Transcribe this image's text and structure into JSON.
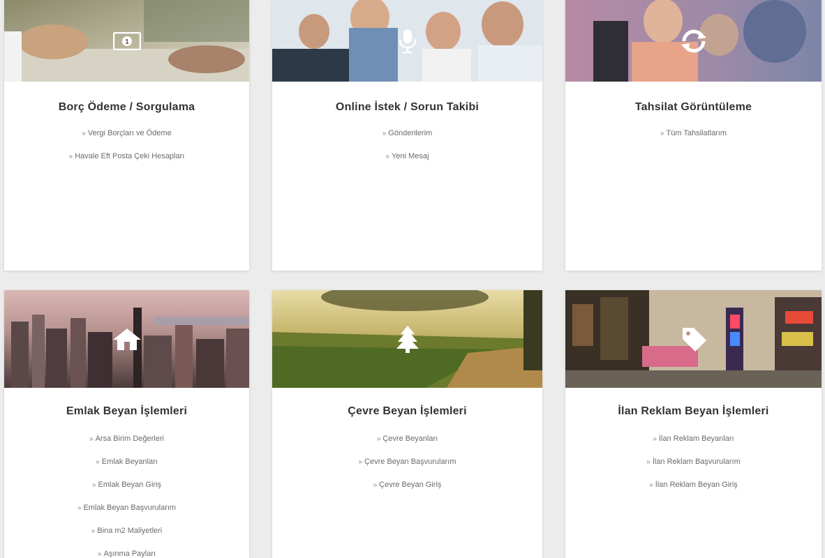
{
  "cards": [
    {
      "title": "Borç Ödeme / Sorgulama",
      "icon": "money-icon",
      "links": [
        "Vergi Borçları ve Ödeme",
        "Havale Eft Posta Çeki Hesapları"
      ]
    },
    {
      "title": "Online İstek / Sorun Takibi",
      "icon": "microphone-icon",
      "links": [
        "Gönderilerim",
        "Yeni Mesaj"
      ]
    },
    {
      "title": "Tahsilat Görüntüleme",
      "icon": "refresh-icon",
      "links": [
        "Tüm Tahsilatlarım"
      ]
    },
    {
      "title": "Emlak Beyan İşlemleri",
      "icon": "home-icon",
      "links": [
        "Arsa Birim Değerleri",
        "Emlak Beyanları",
        "Emlak Beyan Giriş",
        "Emlak Beyan Başvurularım",
        "Bina m2 Maliyetleri",
        "Aşınma Payları"
      ]
    },
    {
      "title": "Çevre Beyan İşlemleri",
      "icon": "tree-icon",
      "links": [
        "Çevre Beyanları",
        "Çevre Beyan Başvurularım",
        "Çevre Beyan Giriş"
      ]
    },
    {
      "title": "İlan Reklam Beyan İşlemleri",
      "icon": "tag-icon",
      "links": [
        "İlan Reklam Beyanları",
        "İlan Reklam Başvurularım",
        "İlan Reklam Beyan Giriş"
      ]
    }
  ],
  "link_arrow": "»"
}
